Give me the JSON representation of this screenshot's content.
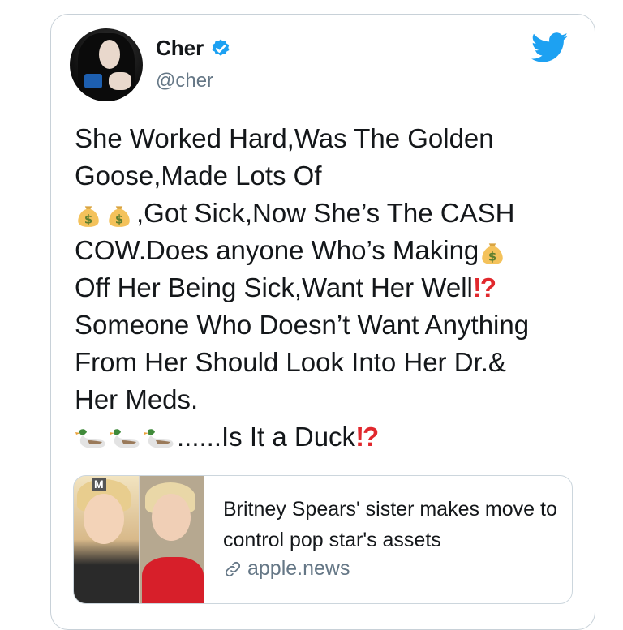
{
  "author": {
    "name": "Cher",
    "handle": "@cher"
  },
  "tweet": {
    "lines": [
      "She Worked Hard,Was The Golden",
      "Goose,Made Lots Of",
      ",Got Sick,Now She’s The CASH",
      "COW.Does anyone Who’s Making",
      "Off Her Being Sick,Want Her Well",
      "Someone Who Doesn’t Want Anything",
      "From Her Should Look Into Her Dr.&",
      "Her Meds.",
      "......Is It a Duck"
    ]
  },
  "link_card": {
    "title": "Britney Spears' sister makes move to control pop star's assets",
    "domain": "apple.news",
    "thumb_logo": "M"
  },
  "icons": {
    "verified": "verified-badge-icon",
    "brand": "twitter-bird-icon",
    "money": "money-bag-emoji",
    "duck": "duck-emoji",
    "interrobang": "exclamation-question-mark-emoji",
    "link": "link-icon"
  },
  "colors": {
    "twitter_blue": "#1da1f2",
    "text": "#14171a",
    "muted": "#657786",
    "interrobang": "#e1282d"
  }
}
